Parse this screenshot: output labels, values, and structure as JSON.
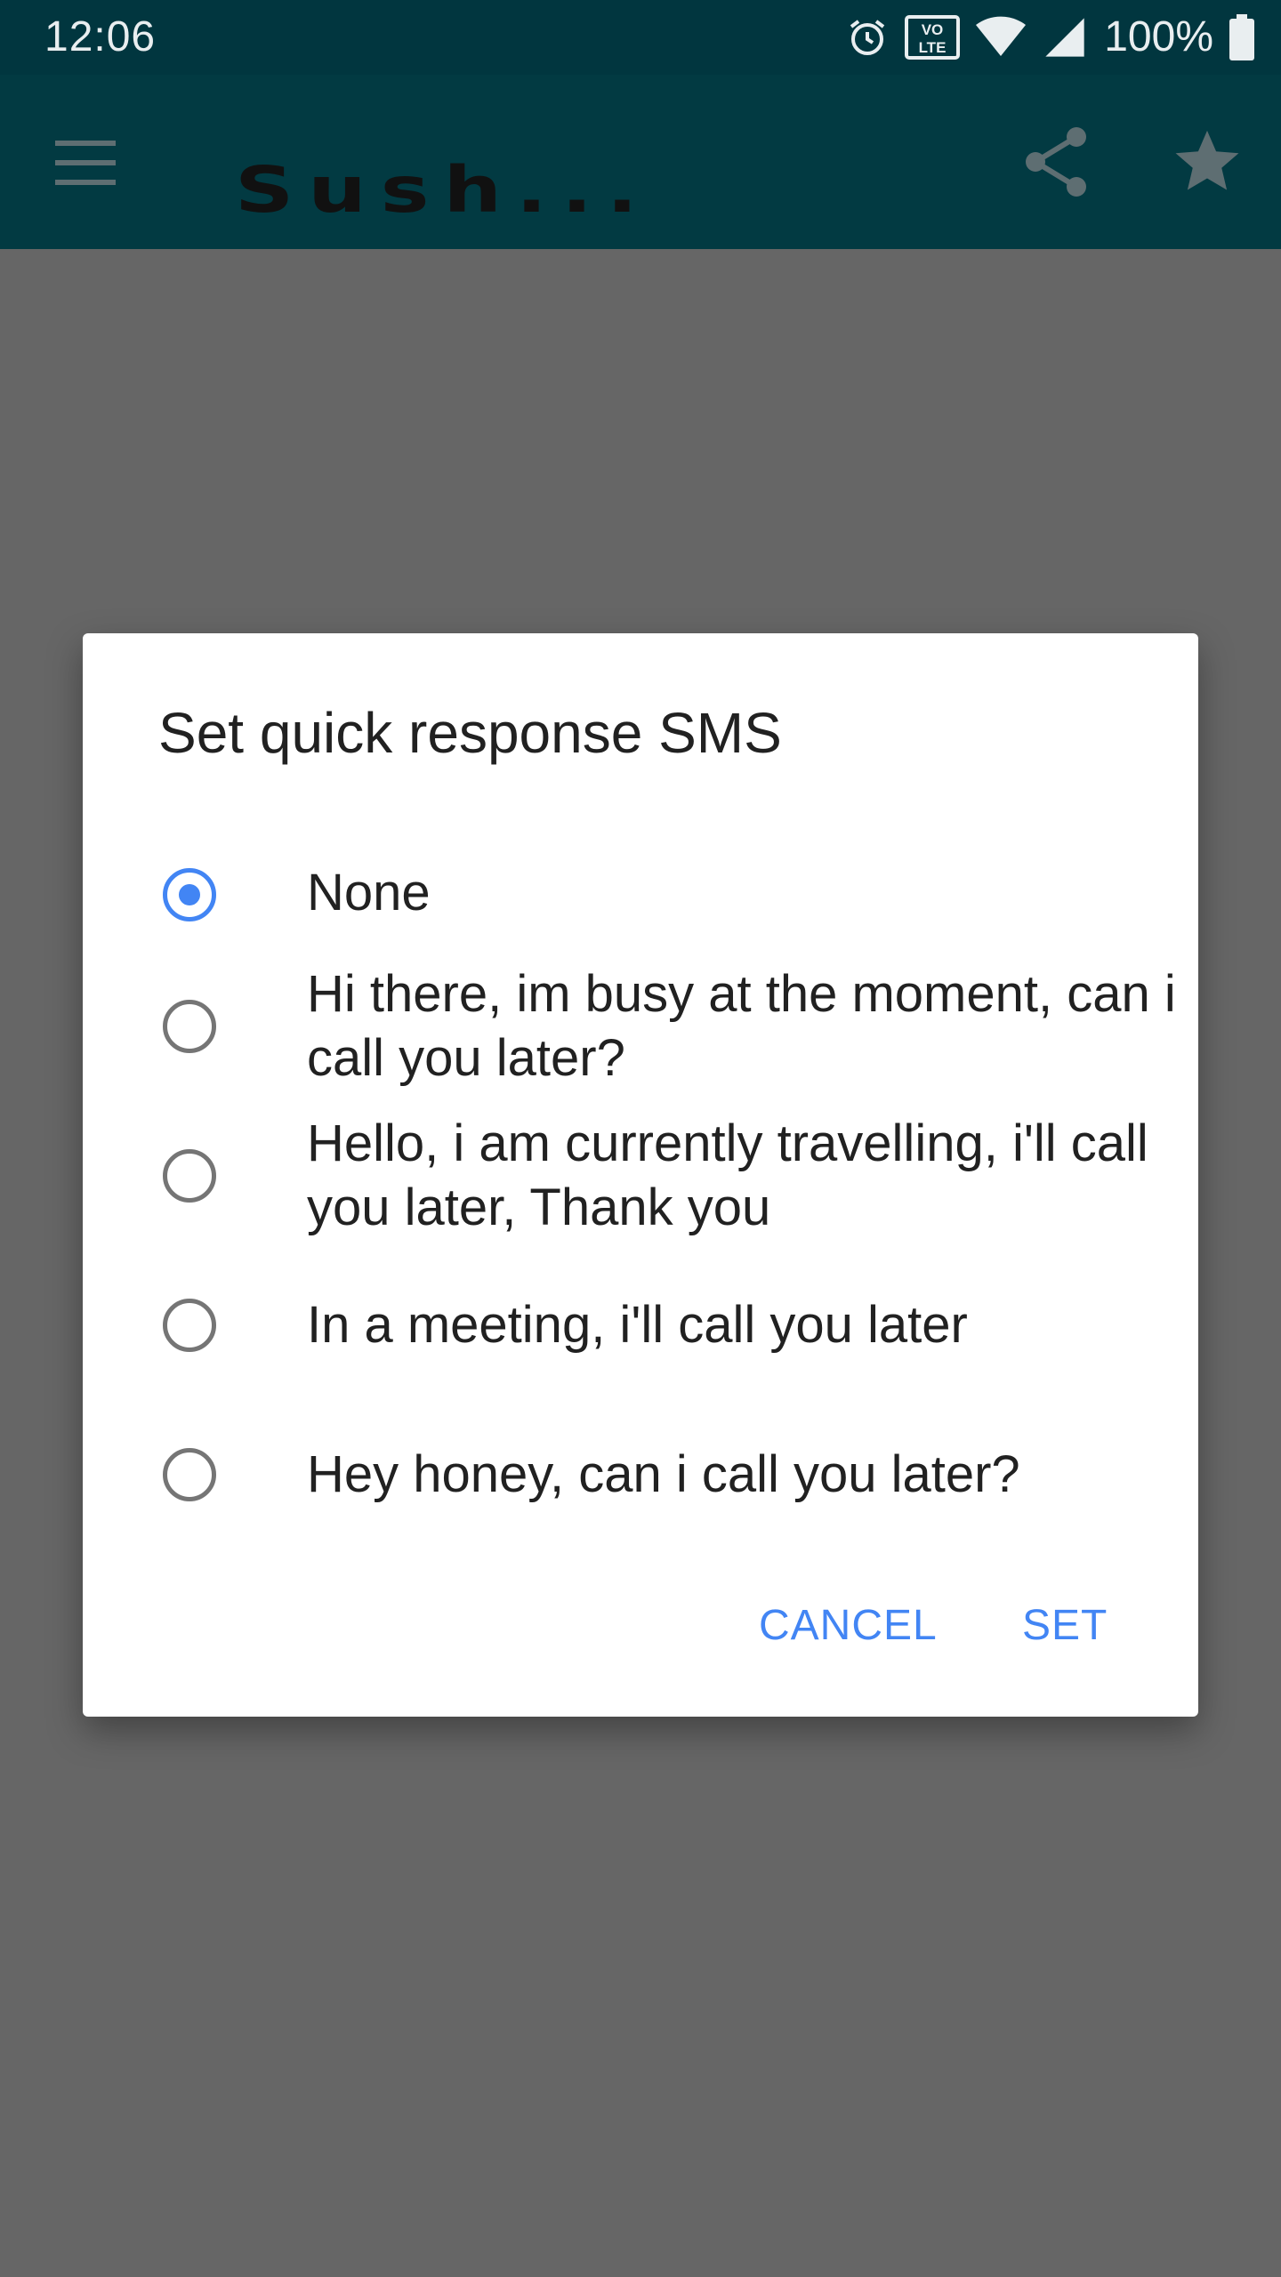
{
  "status_bar": {
    "time": "12:06",
    "battery": "100%",
    "icons": [
      "alarm-icon",
      "volte-icon",
      "wifi-icon",
      "signal-icon",
      "battery-icon"
    ],
    "volte_text_top": "VO",
    "volte_text_bottom": "LTE"
  },
  "app_bar": {
    "title": "Sush...",
    "icons": [
      "menu-icon",
      "share-icon",
      "star-icon"
    ]
  },
  "dialog": {
    "title": "Set quick response SMS",
    "options": [
      {
        "label": "None",
        "selected": true
      },
      {
        "label": "Hi there, im busy at the moment, can i call you later?",
        "selected": false
      },
      {
        "label": "Hello, i am currently travelling, i'll call you later, Thank you",
        "selected": false
      },
      {
        "label": "In a meeting, i'll call you later",
        "selected": false
      },
      {
        "label": "Hey honey, can i call you later?",
        "selected": false
      }
    ],
    "cancel_label": "CANCEL",
    "set_label": "SET"
  },
  "colors": {
    "status_bar": "#01363f",
    "scrim": "#666666",
    "accent": "#4285f4",
    "dialog": "#ffffff"
  }
}
